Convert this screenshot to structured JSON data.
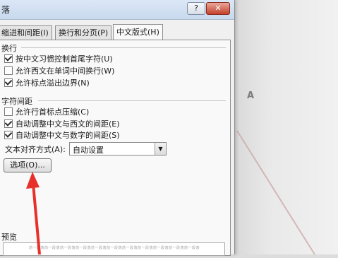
{
  "dialog": {
    "title": "落",
    "help_label": "?",
    "close_label": "✕"
  },
  "tabs": [
    {
      "label": "缩进和间距(I)",
      "active": false
    },
    {
      "label": "换行和分页(P)",
      "active": false
    },
    {
      "label": "中文版式(H)",
      "active": true
    }
  ],
  "line_break": {
    "group_label": "换行",
    "options": [
      {
        "label": "按中文习惯控制首尾字符(U)",
        "checked": true
      },
      {
        "label": "允许西文在单词中间换行(W)",
        "checked": false
      },
      {
        "label": "允许标点溢出边界(N)",
        "checked": true
      }
    ]
  },
  "char_spacing": {
    "group_label": "字符间距",
    "options": [
      {
        "label": "允许行首标点压缩(C)",
        "checked": false
      },
      {
        "label": "自动调整中文与西文的间距(E)",
        "checked": true
      },
      {
        "label": "自动调整中文与数字的间距(S)",
        "checked": true
      }
    ]
  },
  "text_alignment": {
    "label": "文本对齐方式(A):",
    "value": "自动设置"
  },
  "options_button": "选项(O)...",
  "preview": {
    "label": "预览",
    "sample_text": "前一段落前一段落前一段落前一段落前一段落前一段落前一段落前一段落前一段落前一段落前一段落"
  },
  "background": {
    "glyph": "A"
  },
  "colors": {
    "annotation_arrow": "#e8302a",
    "dialog_bg": "#f0f0f0",
    "titlebar": "#c8d9ee"
  },
  "icons": {
    "help": "help-icon",
    "close": "close-icon",
    "dropdown": "chevron-down-icon"
  }
}
